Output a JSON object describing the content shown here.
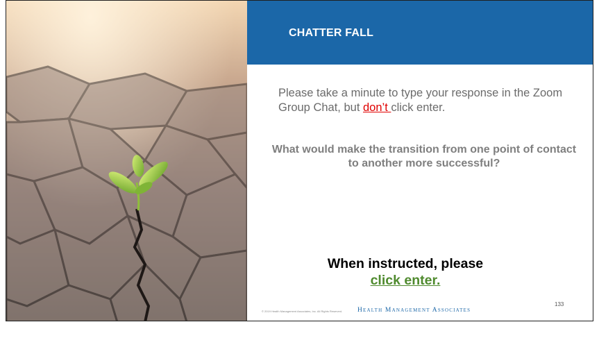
{
  "slide": {
    "title": "CHATTER FALL",
    "prompt_before": "Please take a minute to type your response in the Zoom Group Chat, but ",
    "prompt_emphasis": "don’t ",
    "prompt_after": "click enter.",
    "question": "What would make the transition from one point of contact to another more successful?",
    "instruction_line1": "When instructed, please",
    "instruction_action": "click enter.",
    "footer_copyright": "© 2019 Health Management Associates, Inc. All Rights Reserved.",
    "footer_brand": "Health Management Associates",
    "page_number": "133"
  },
  "colors": {
    "header_bg": "#1b67a8",
    "emphasis": "#e00000",
    "action": "#4f8a2e"
  },
  "image": {
    "subject": "seedling-in-cracked-earth"
  }
}
